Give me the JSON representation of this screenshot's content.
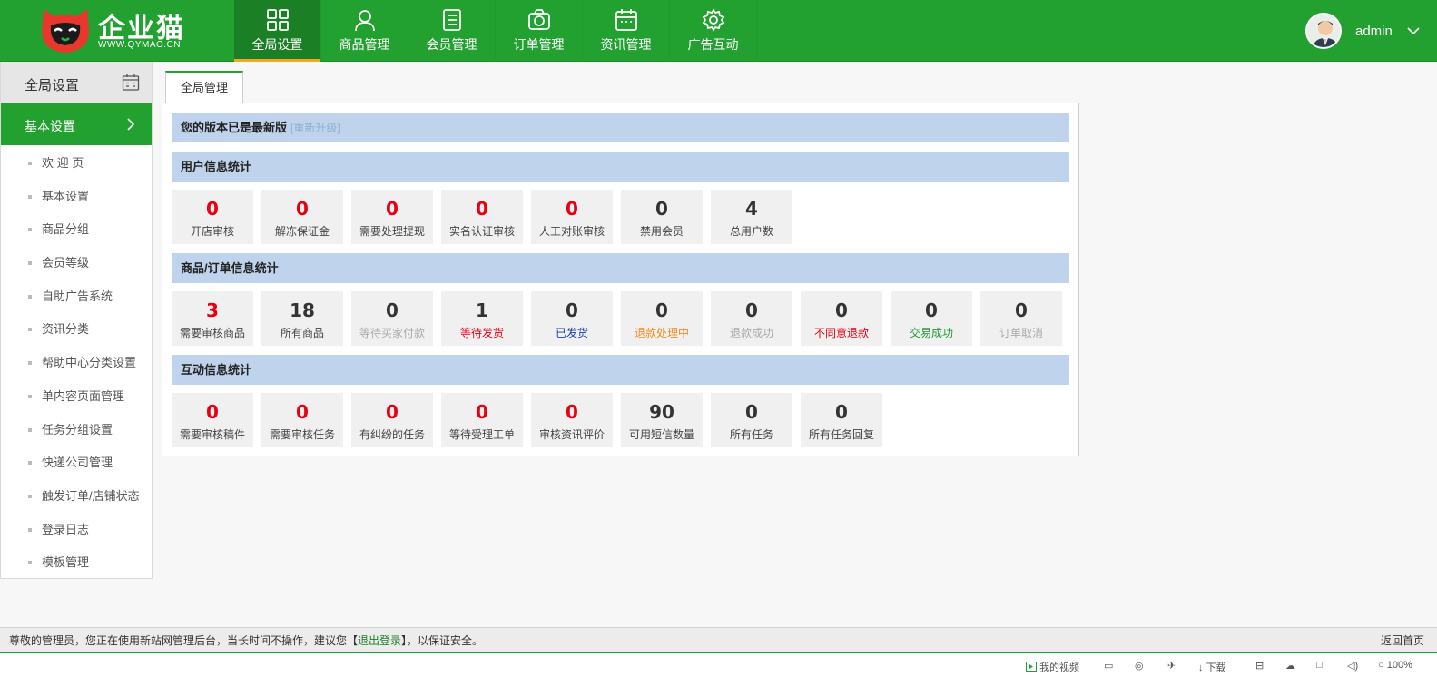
{
  "brand": {
    "name": "企业猫",
    "url": "WWW.QYMAO.CN"
  },
  "nav": [
    {
      "label": "全局设置",
      "icon": "grid-icon"
    },
    {
      "label": "商品管理",
      "icon": "person-icon"
    },
    {
      "label": "会员管理",
      "icon": "list-icon"
    },
    {
      "label": "订单管理",
      "icon": "camera-icon"
    },
    {
      "label": "资讯管理",
      "icon": "calendar-icon"
    },
    {
      "label": "广告互动",
      "icon": "gear-icon"
    }
  ],
  "user": {
    "name": "admin"
  },
  "sidebar": {
    "title": "全局设置",
    "section": "基本设置",
    "items": [
      "欢 迎 页",
      "基本设置",
      "商品分组",
      "会员等级",
      "自助广告系统",
      "资讯分类",
      "帮助中心分类设置",
      "单内容页面管理",
      "任务分组设置",
      "快递公司管理",
      "触发订单/店铺状态",
      "登录日志",
      "模板管理"
    ]
  },
  "tab": {
    "label": "全局管理"
  },
  "version": {
    "text": "您的版本已是最新版",
    "upgrade": "[重新升级]"
  },
  "sections": {
    "users": {
      "title": "用户信息统计",
      "stats": [
        {
          "value": "0",
          "label": "开店审核"
        },
        {
          "value": "0",
          "label": "解冻保证金"
        },
        {
          "value": "0",
          "label": "需要处理提现"
        },
        {
          "value": "0",
          "label": "实名认证审核"
        },
        {
          "value": "0",
          "label": "人工对账审核"
        },
        {
          "value": "0",
          "label": "禁用会员"
        },
        {
          "value": "4",
          "label": "总用户数"
        }
      ]
    },
    "goods": {
      "title": "商品/订单信息统计",
      "stats": [
        {
          "value": "3",
          "label": "需要审核商品"
        },
        {
          "value": "18",
          "label": "所有商品"
        },
        {
          "value": "0",
          "label": "等待买家付款"
        },
        {
          "value": "1",
          "label": "等待发货"
        },
        {
          "value": "0",
          "label": "已发货"
        },
        {
          "value": "0",
          "label": "退款处理中"
        },
        {
          "value": "0",
          "label": "退款成功"
        },
        {
          "value": "0",
          "label": "不同意退款"
        },
        {
          "value": "0",
          "label": "交易成功"
        },
        {
          "value": "0",
          "label": "订单取消"
        }
      ]
    },
    "interaction": {
      "title": "互动信息统计",
      "stats": [
        {
          "value": "0",
          "label": "需要审核稿件"
        },
        {
          "value": "0",
          "label": "需要审核任务"
        },
        {
          "value": "0",
          "label": "有纠纷的任务"
        },
        {
          "value": "0",
          "label": "等待受理工单"
        },
        {
          "value": "0",
          "label": "审核资讯评价"
        },
        {
          "value": "90",
          "label": "可用短信数量"
        },
        {
          "value": "0",
          "label": "所有任务"
        },
        {
          "value": "0",
          "label": "所有任务回复"
        }
      ]
    }
  },
  "footer": {
    "prefix": "尊敬的管理员，您正在使用新站网管理后台，当长时间不操作，建议您【",
    "logout": "退出登录",
    "suffix": "】，以保证安全。",
    "right": "返回首页"
  },
  "statusbar": {
    "video": "我的视频",
    "download": "下载",
    "zoom": "100%"
  },
  "colors": {
    "brand_green": "#22a130",
    "section_blue": "#c0d3ec",
    "alert_red": "#e60012"
  }
}
